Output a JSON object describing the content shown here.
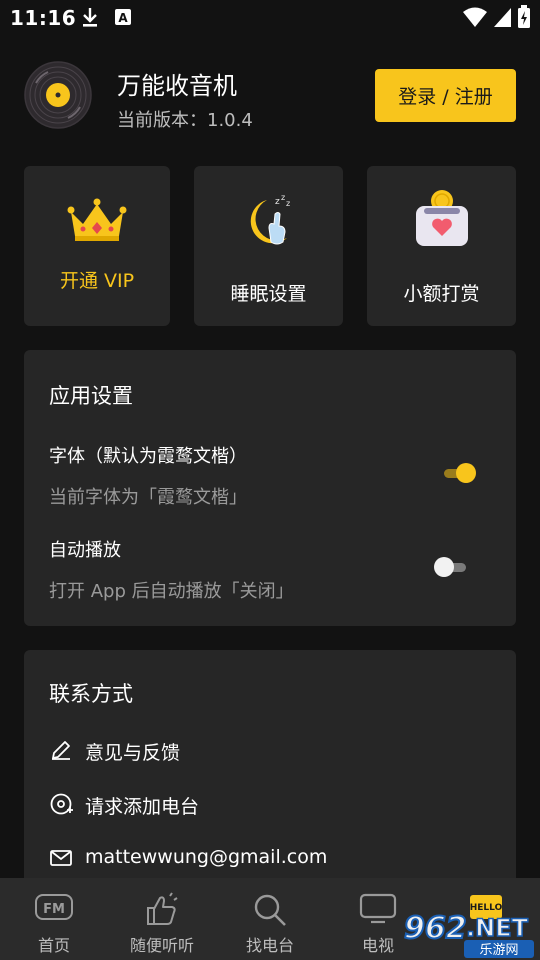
{
  "status_bar": {
    "time": "11:16"
  },
  "profile": {
    "app_name": "万能收音机",
    "version": "当前版本：1.0.4",
    "login_label": "登录 / 注册"
  },
  "quick_actions": [
    {
      "label": "开通 VIP",
      "icon": "crown-icon",
      "color": "#f8c51c"
    },
    {
      "label": "睡眠设置",
      "icon": "sleep-moon-icon",
      "color": "#ffffff"
    },
    {
      "label": "小额打赏",
      "icon": "donation-box-icon",
      "color": "#ffffff"
    }
  ],
  "app_settings": {
    "title": "应用设置",
    "items": [
      {
        "title": "字体（默认为霞鹜文楷）",
        "desc": "当前字体为「霞鹜文楷」",
        "enabled": true
      },
      {
        "title": "自动播放",
        "desc": "打开 App 后自动播放「关闭」",
        "enabled": false
      }
    ]
  },
  "contact": {
    "title": "联系方式",
    "items": [
      {
        "icon": "pencil-icon",
        "label": "意见与反馈"
      },
      {
        "icon": "radio-add-icon",
        "label": "请求添加电台"
      },
      {
        "icon": "mail-icon",
        "label": "mattewwung@gmail.com"
      }
    ]
  },
  "bottom_nav": [
    {
      "icon": "fm-icon",
      "label": "首页"
    },
    {
      "icon": "hand-icon",
      "label": "随便听听"
    },
    {
      "icon": "search-icon",
      "label": "找电台"
    },
    {
      "icon": "tv-icon",
      "label": "电视"
    },
    {
      "icon": "hello-icon",
      "label": ""
    }
  ],
  "watermark": {
    "brand": "962.NET",
    "sub": "乐游网"
  },
  "colors": {
    "accent": "#f8c51c",
    "card": "#262626",
    "background": "#121212"
  }
}
